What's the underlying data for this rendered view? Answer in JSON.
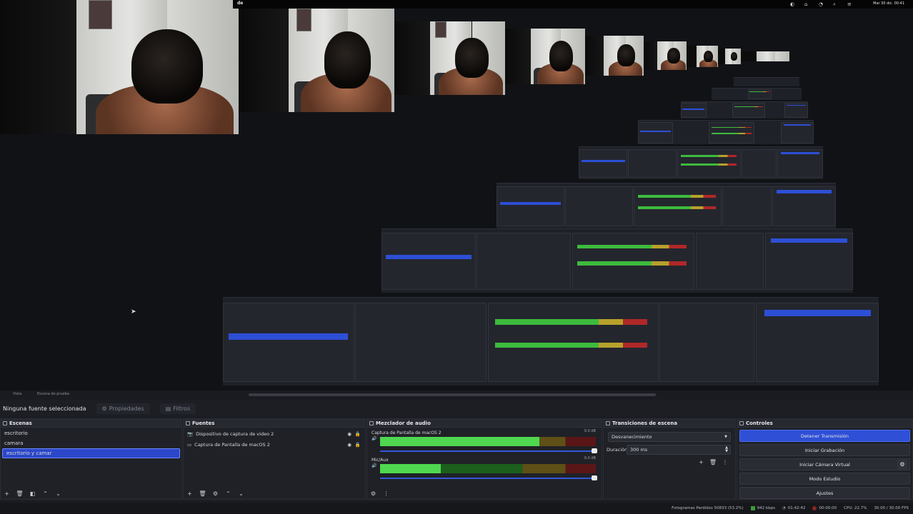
{
  "menubar": {
    "app": "de",
    "clock": "Mar 30 dic. 00:41"
  },
  "nav": {
    "crumbs": [
      "Vista",
      "Escena de prueba"
    ]
  },
  "toolbar": {
    "no_selection": "Ninguna fuente seleccionada",
    "properties": "Propiedades",
    "filters": "Filtros"
  },
  "scenes": {
    "title": "Escenas",
    "items": [
      {
        "label": "escritorio",
        "selected": false
      },
      {
        "label": "camara",
        "selected": false
      },
      {
        "label": "escritorio y camar",
        "selected": true
      }
    ]
  },
  "sources": {
    "title": "Fuentes",
    "items": [
      {
        "label": "Dispositivo de captura de video 2",
        "icon": "camera-icon"
      },
      {
        "label": "Captura de Pantalla de macOS 2",
        "icon": "monitor-icon"
      }
    ]
  },
  "mixer": {
    "title": "Mezclador de audio",
    "channels": [
      {
        "name": "Captura de Pantalla de macOS 2",
        "db": "0.0 dB",
        "level": 0.74
      },
      {
        "name": "Mic/Aux",
        "db": "0.0 dB",
        "level": 0.28
      }
    ]
  },
  "transitions": {
    "title": "Transiciones de escena",
    "selected": "Desvanecimiento",
    "duration_label": "Duración",
    "duration_value": "300 ms"
  },
  "controls": {
    "title": "Controles",
    "buttons": [
      "Detener Transmisión",
      "Iniciar Grabación",
      "Iniciar Cámara Virtual",
      "Modo Estudio",
      "Ajustes"
    ]
  },
  "status": {
    "dropped": "Fotogramas Perdidos 50833 (53.2%)",
    "bitrate": "942 kbps",
    "live_time": "01:42:42",
    "rec_time": "00:00:00",
    "cpu": "CPU: 22.7%",
    "fps": "30.00 / 30.00 FPS"
  },
  "colors": {
    "accent": "#2e4fd6",
    "background": "#1b1c22",
    "meter_green": "#4fd84f",
    "meter_red": "#b02828"
  }
}
